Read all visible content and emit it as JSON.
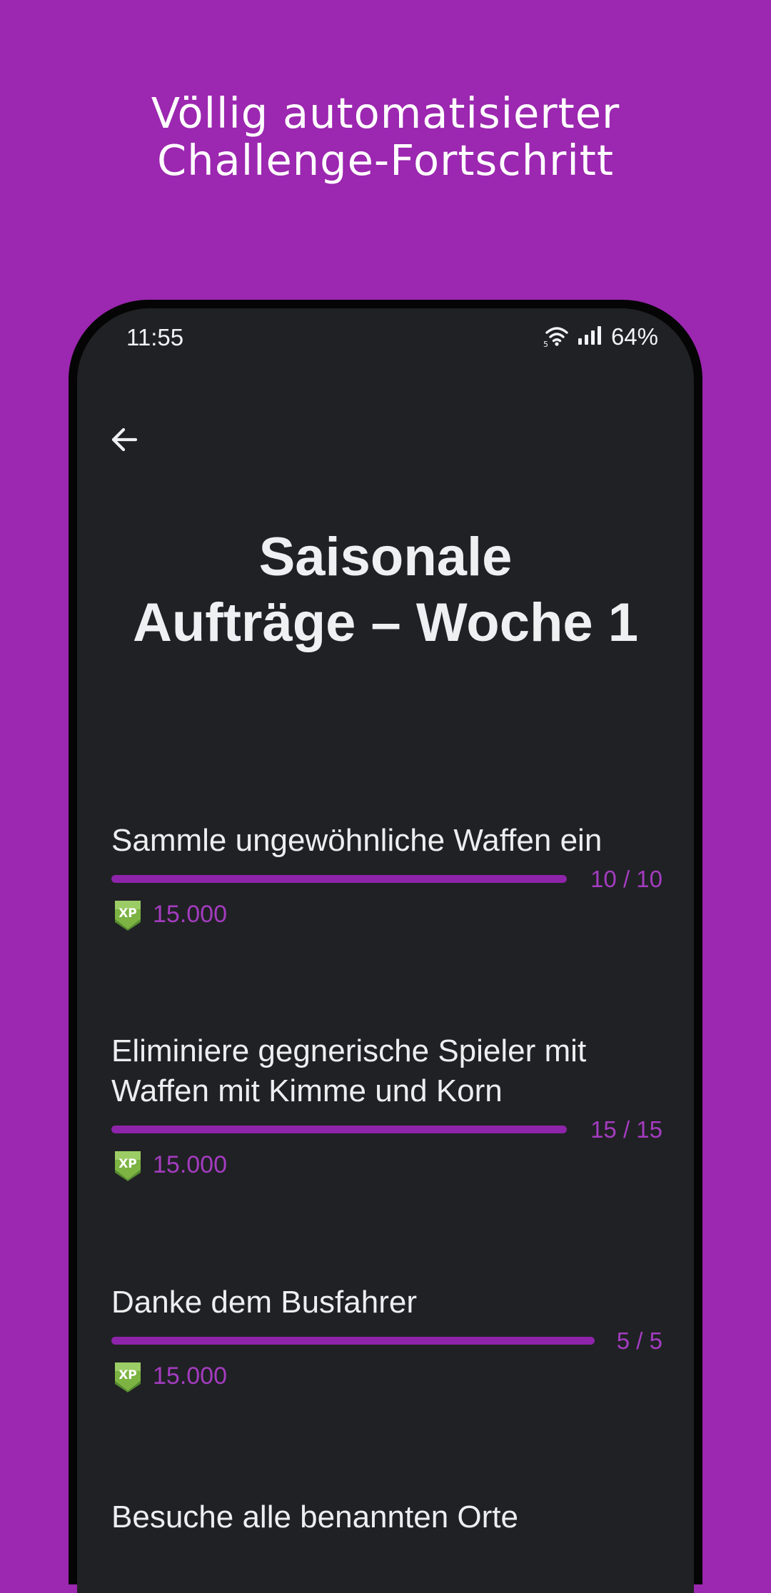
{
  "headline": {
    "line1": "Völlig automatisierter",
    "line2": "Challenge-Fortschritt"
  },
  "status_bar": {
    "time": "11:55",
    "battery": "64%",
    "wifi_badge": "5"
  },
  "icons": {
    "back": "arrow-left-icon",
    "wifi": "wifi-icon",
    "signal": "cell-signal-icon",
    "xp": "xp-badge-icon"
  },
  "page": {
    "title_line1": "Saisonale",
    "title_line2": "Aufträge – Woche 1"
  },
  "colors": {
    "background": "#9c27b0",
    "screen": "#202124",
    "accent": "#8e24aa",
    "accent_text": "#a43cc0"
  },
  "challenges": [
    {
      "title": "Sammle ungewöhnliche Waffen ein",
      "progress_text": "10 / 10",
      "progress": 1.0,
      "reward": "15.000"
    },
    {
      "title": "Eliminiere gegnerische Spieler mit Waffen mit Kimme und Korn",
      "progress_text": "15 / 15",
      "progress": 1.0,
      "reward": "15.000"
    },
    {
      "title": "Danke dem Busfahrer",
      "progress_text": "5 / 5",
      "progress": 1.0,
      "reward": "15.000"
    },
    {
      "title": "Besuche alle benannten Orte"
    }
  ]
}
